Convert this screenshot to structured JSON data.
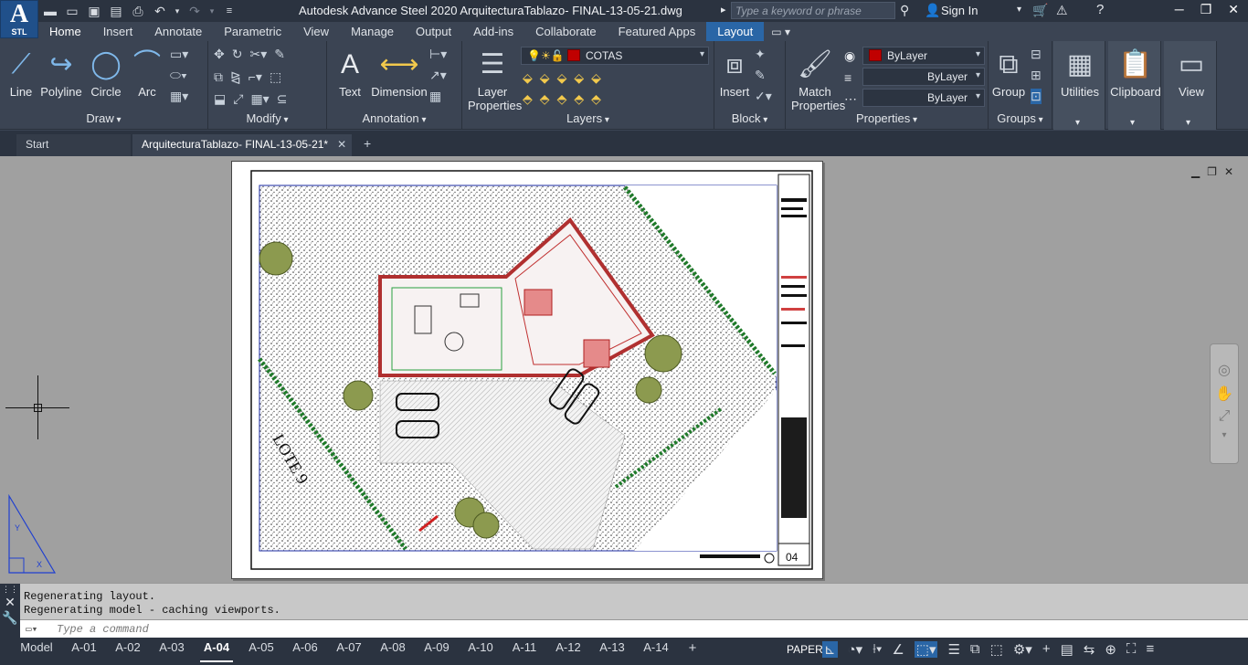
{
  "app": {
    "logo": "A",
    "logo_sub": "STL",
    "title": "Autodesk Advance Steel 2020   ArquitecturaTablazo- FINAL-13-05-21.dwg"
  },
  "search": {
    "placeholder": "Type a keyword or phrase"
  },
  "account": {
    "sign_in": "Sign In"
  },
  "ribbon_tabs": [
    "Home",
    "Insert",
    "Annotate",
    "Parametric",
    "View",
    "Manage",
    "Output",
    "Add-ins",
    "Collaborate",
    "Featured Apps",
    "Layout"
  ],
  "ribbon": {
    "draw": {
      "title": "Draw",
      "line": "Line",
      "polyline": "Polyline",
      "circle": "Circle",
      "arc": "Arc"
    },
    "modify": {
      "title": "Modify"
    },
    "annotation": {
      "title": "Annotation",
      "text": "Text",
      "dimension": "Dimension"
    },
    "layers": {
      "title": "Layers",
      "layer_properties": "Layer Properties",
      "current_layer": "COTAS"
    },
    "block": {
      "title": "Block",
      "insert": "Insert"
    },
    "properties": {
      "title": "Properties",
      "match": "Match Properties",
      "color": "ByLayer",
      "linetype": "ByLayer",
      "lineweight": "ByLayer"
    },
    "groups": {
      "title": "Groups",
      "group": "Group"
    },
    "utilities": {
      "label": "Utilities"
    },
    "clipboard": {
      "label": "Clipboard"
    },
    "view": {
      "label": "View"
    }
  },
  "file_tabs": {
    "start": "Start",
    "document": "ArquitecturaTablazo- FINAL-13-05-21*"
  },
  "drawing": {
    "sheet_number": "04",
    "lot_label": "LOTE 9"
  },
  "command": {
    "history": [
      "Regenerating layout.",
      "Regenerating model - caching viewports."
    ],
    "placeholder": "Type a command"
  },
  "layout_tabs": [
    "Model",
    "A-01",
    "A-02",
    "A-03",
    "A-04",
    "A-05",
    "A-06",
    "A-07",
    "A-08",
    "A-09",
    "A-10",
    "A-11",
    "A-12",
    "A-13",
    "A-14"
  ],
  "active_layout": "A-04",
  "status": {
    "space": "PAPER"
  },
  "colors": {
    "accent": "#2a66a6",
    "layer_color": "#c00000"
  }
}
